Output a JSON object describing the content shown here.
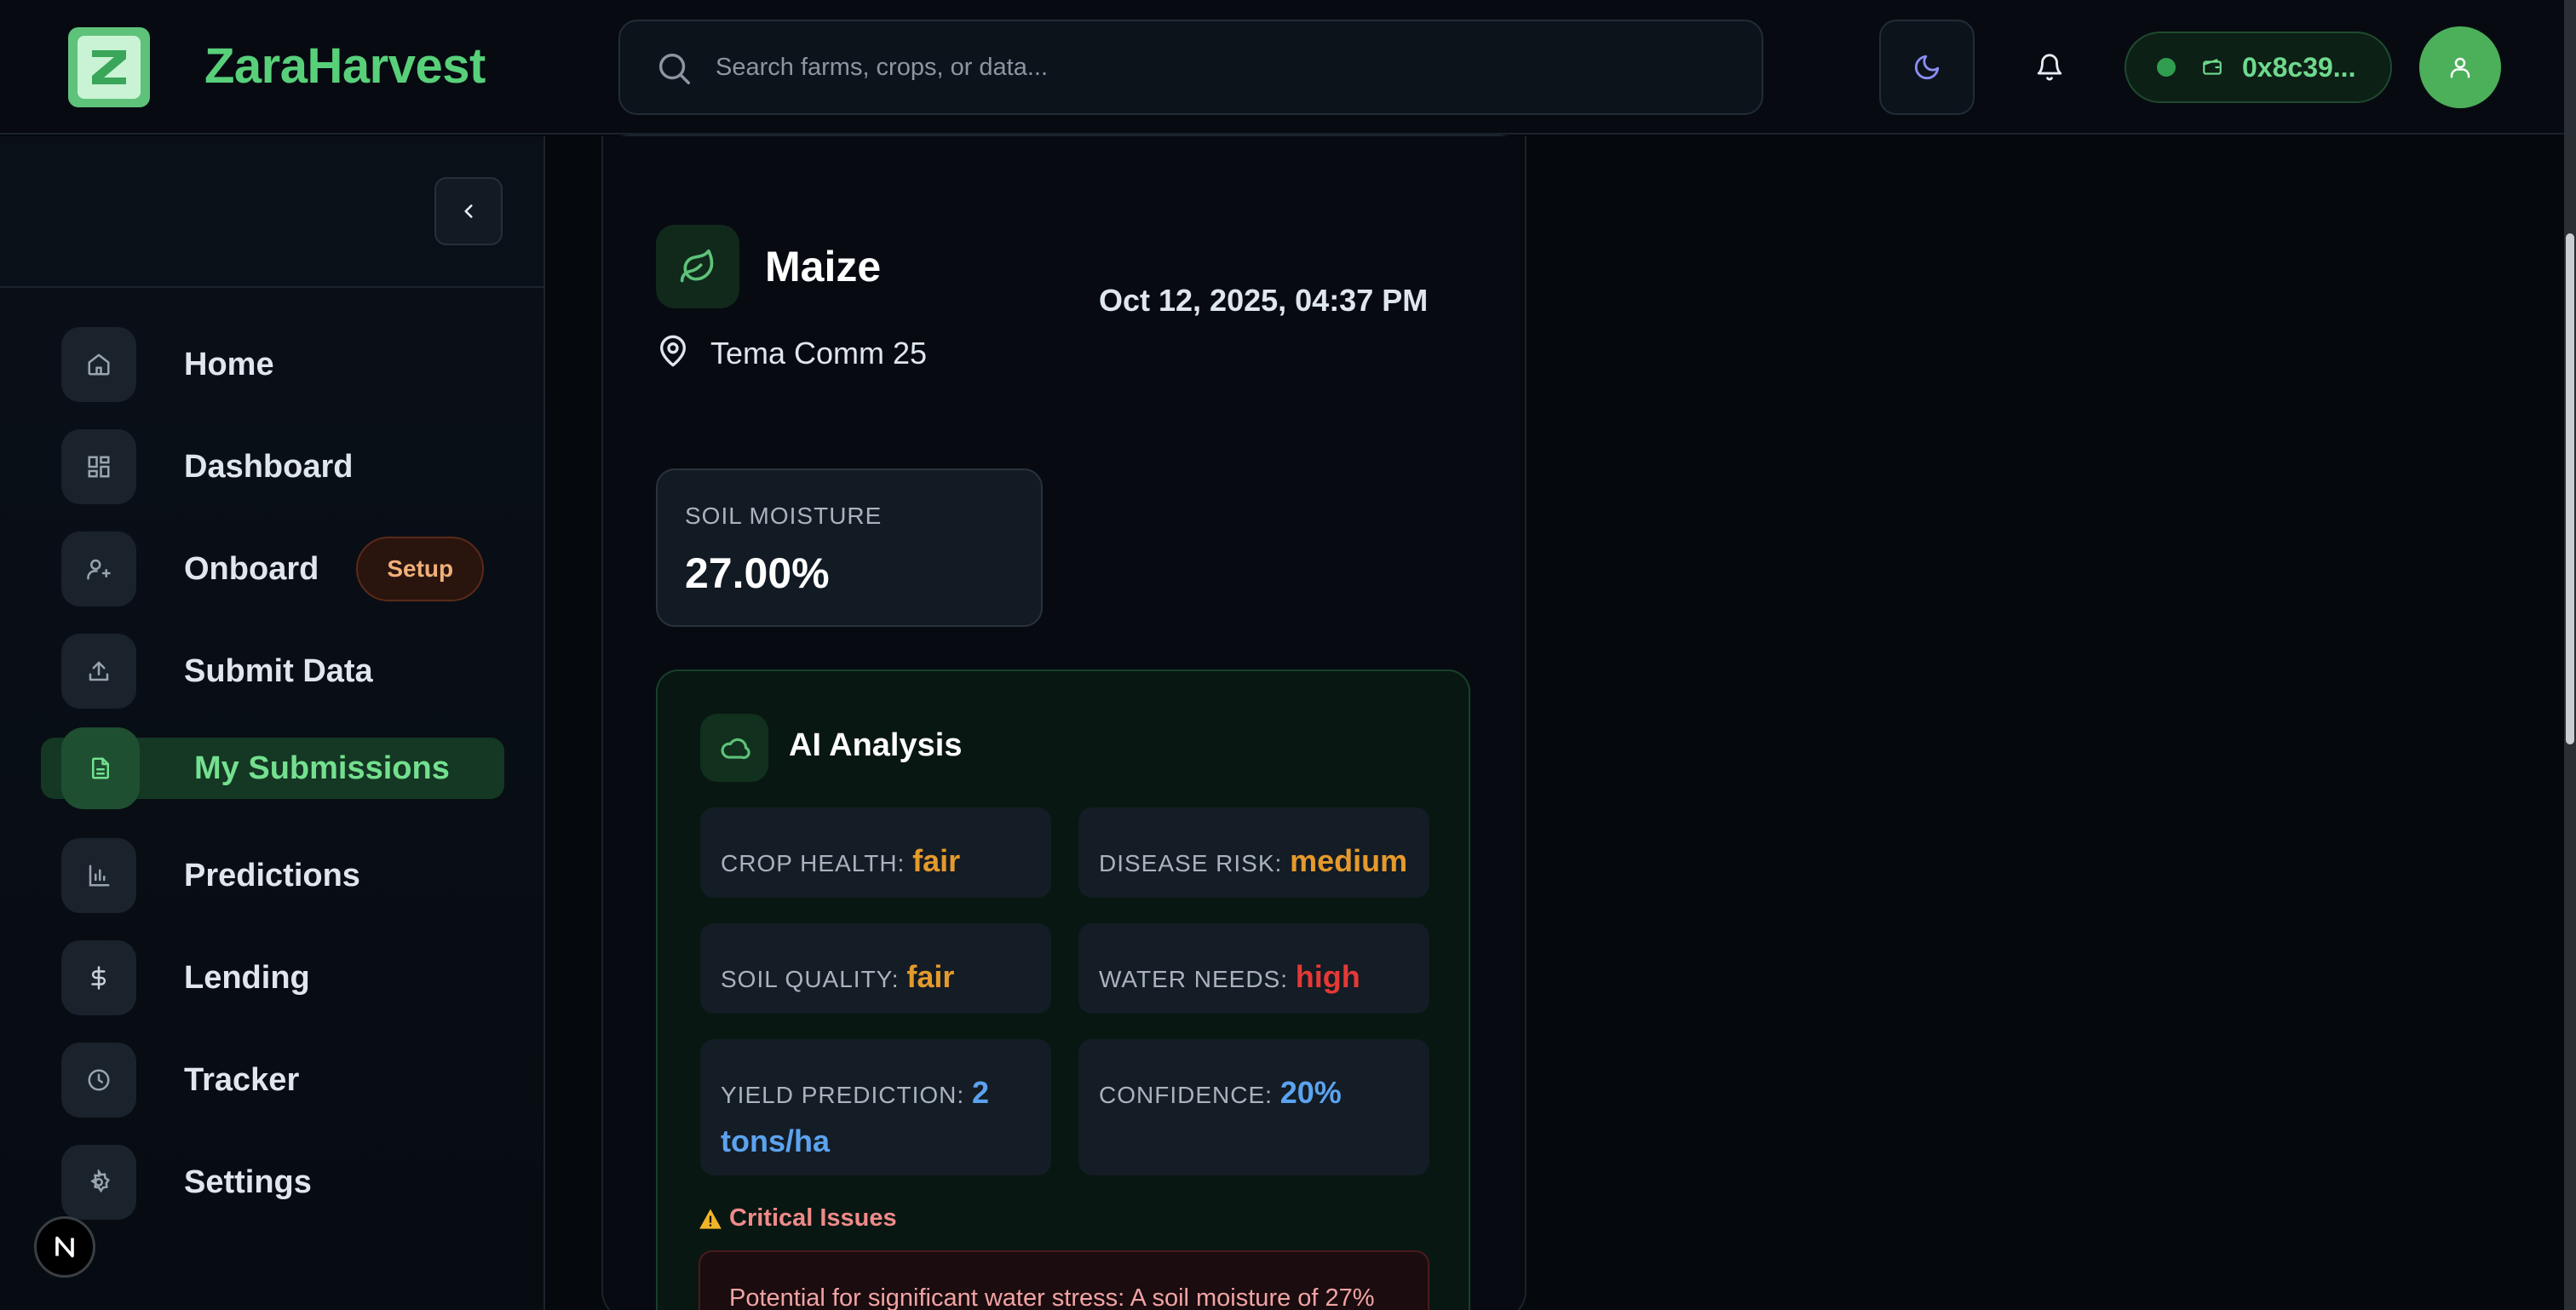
{
  "header": {
    "brand": "ZaraHarvest",
    "search_placeholder": "Search farms, crops, or data...",
    "wallet_address": "0x8c39..."
  },
  "sidebar": {
    "items": [
      {
        "label": "Home",
        "icon": "home-icon"
      },
      {
        "label": "Dashboard",
        "icon": "dashboard-icon"
      },
      {
        "label": "Onboard",
        "icon": "user-plus-icon",
        "badge": "Setup"
      },
      {
        "label": "Submit Data",
        "icon": "upload-icon"
      },
      {
        "label": "My Submissions",
        "icon": "document-icon",
        "active": true
      },
      {
        "label": "Predictions",
        "icon": "bar-chart-icon"
      },
      {
        "label": "Lending",
        "icon": "dollar-icon"
      },
      {
        "label": "Tracker",
        "icon": "clock-icon"
      },
      {
        "label": "Settings",
        "icon": "gear-icon"
      }
    ],
    "dev_badge": "N"
  },
  "submission": {
    "crop": "Maize",
    "location": "Tema Comm 25",
    "date": "Oct 12, 2025, 04:37 PM",
    "soil_moisture_label": "SOIL MOISTURE",
    "soil_moisture_value": "27.00%"
  },
  "ai_analysis": {
    "title": "AI Analysis",
    "metrics": [
      {
        "label": "CROP HEALTH:",
        "value": "fair",
        "color": "#e59a2b"
      },
      {
        "label": "DISEASE RISK:",
        "value": "medium",
        "color": "#e59a2b"
      },
      {
        "label": "SOIL QUALITY:",
        "value": "fair",
        "color": "#e59a2b"
      },
      {
        "label": "WATER NEEDS:",
        "value": "high",
        "color": "#e53935"
      },
      {
        "label": "YIELD PREDICTION:",
        "value": "2 tons/ha",
        "color": "#5ba3f0"
      },
      {
        "label": "CONFIDENCE:",
        "value": "20%",
        "color": "#5ba3f0"
      }
    ],
    "critical_title": "Critical Issues",
    "critical_text": "Potential for significant water stress: A soil moisture of 27%"
  },
  "colors": {
    "accent": "#58d07a",
    "background": "#05080d",
    "warning": "#e59a2b",
    "danger": "#e53935",
    "info": "#5ba3f0"
  }
}
